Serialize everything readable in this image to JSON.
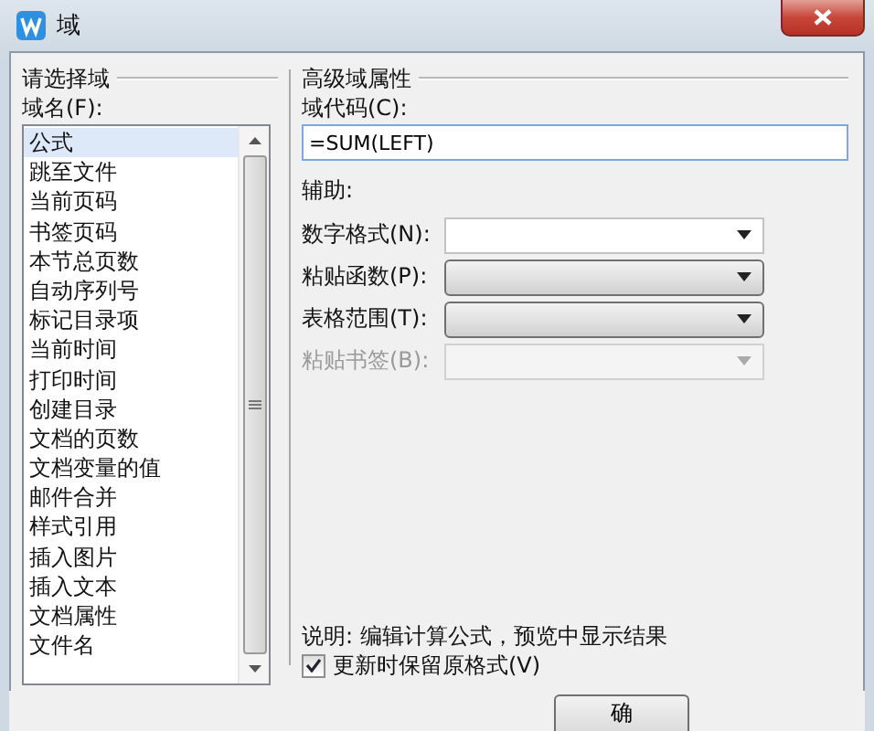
{
  "window": {
    "title": "域"
  },
  "left_group": {
    "title": "请选择域",
    "list_label": "域名(F):",
    "items": [
      {
        "label": "公式",
        "selected": true
      },
      {
        "label": "跳至文件",
        "selected": false
      },
      {
        "label": "当前页码",
        "selected": false
      },
      {
        "label": "书签页码",
        "selected": false
      },
      {
        "label": "本节总页数",
        "selected": false
      },
      {
        "label": "自动序列号",
        "selected": false
      },
      {
        "label": "标记目录项",
        "selected": false
      },
      {
        "label": "当前时间",
        "selected": false
      },
      {
        "label": "打印时间",
        "selected": false
      },
      {
        "label": "创建目录",
        "selected": false
      },
      {
        "label": "文档的页数",
        "selected": false
      },
      {
        "label": "文档变量的值",
        "selected": false
      },
      {
        "label": "邮件合并",
        "selected": false
      },
      {
        "label": "样式引用",
        "selected": false
      },
      {
        "label": "插入图片",
        "selected": false
      },
      {
        "label": "插入文本",
        "selected": false
      },
      {
        "label": "文档属性",
        "selected": false
      },
      {
        "label": "文件名",
        "selected": false
      }
    ]
  },
  "right_group": {
    "title": "高级域属性",
    "code_label": "域代码(C):",
    "code_value": "=SUM(LEFT)",
    "helper_label": "辅助:",
    "combos": [
      {
        "label": "数字格式(N):",
        "kind": "editable",
        "disabled": false
      },
      {
        "label": "粘贴函数(P):",
        "kind": "dropdown",
        "disabled": false
      },
      {
        "label": "表格范围(T):",
        "kind": "dropdown",
        "disabled": false
      },
      {
        "label": "粘贴书签(B):",
        "kind": "editable",
        "disabled": true
      }
    ],
    "description": "说明: 编辑计算公式，预览中显示结果",
    "keep_format": {
      "label": "更新时保留原格式(V)",
      "checked": true
    }
  },
  "buttons": [
    "确"
  ]
}
